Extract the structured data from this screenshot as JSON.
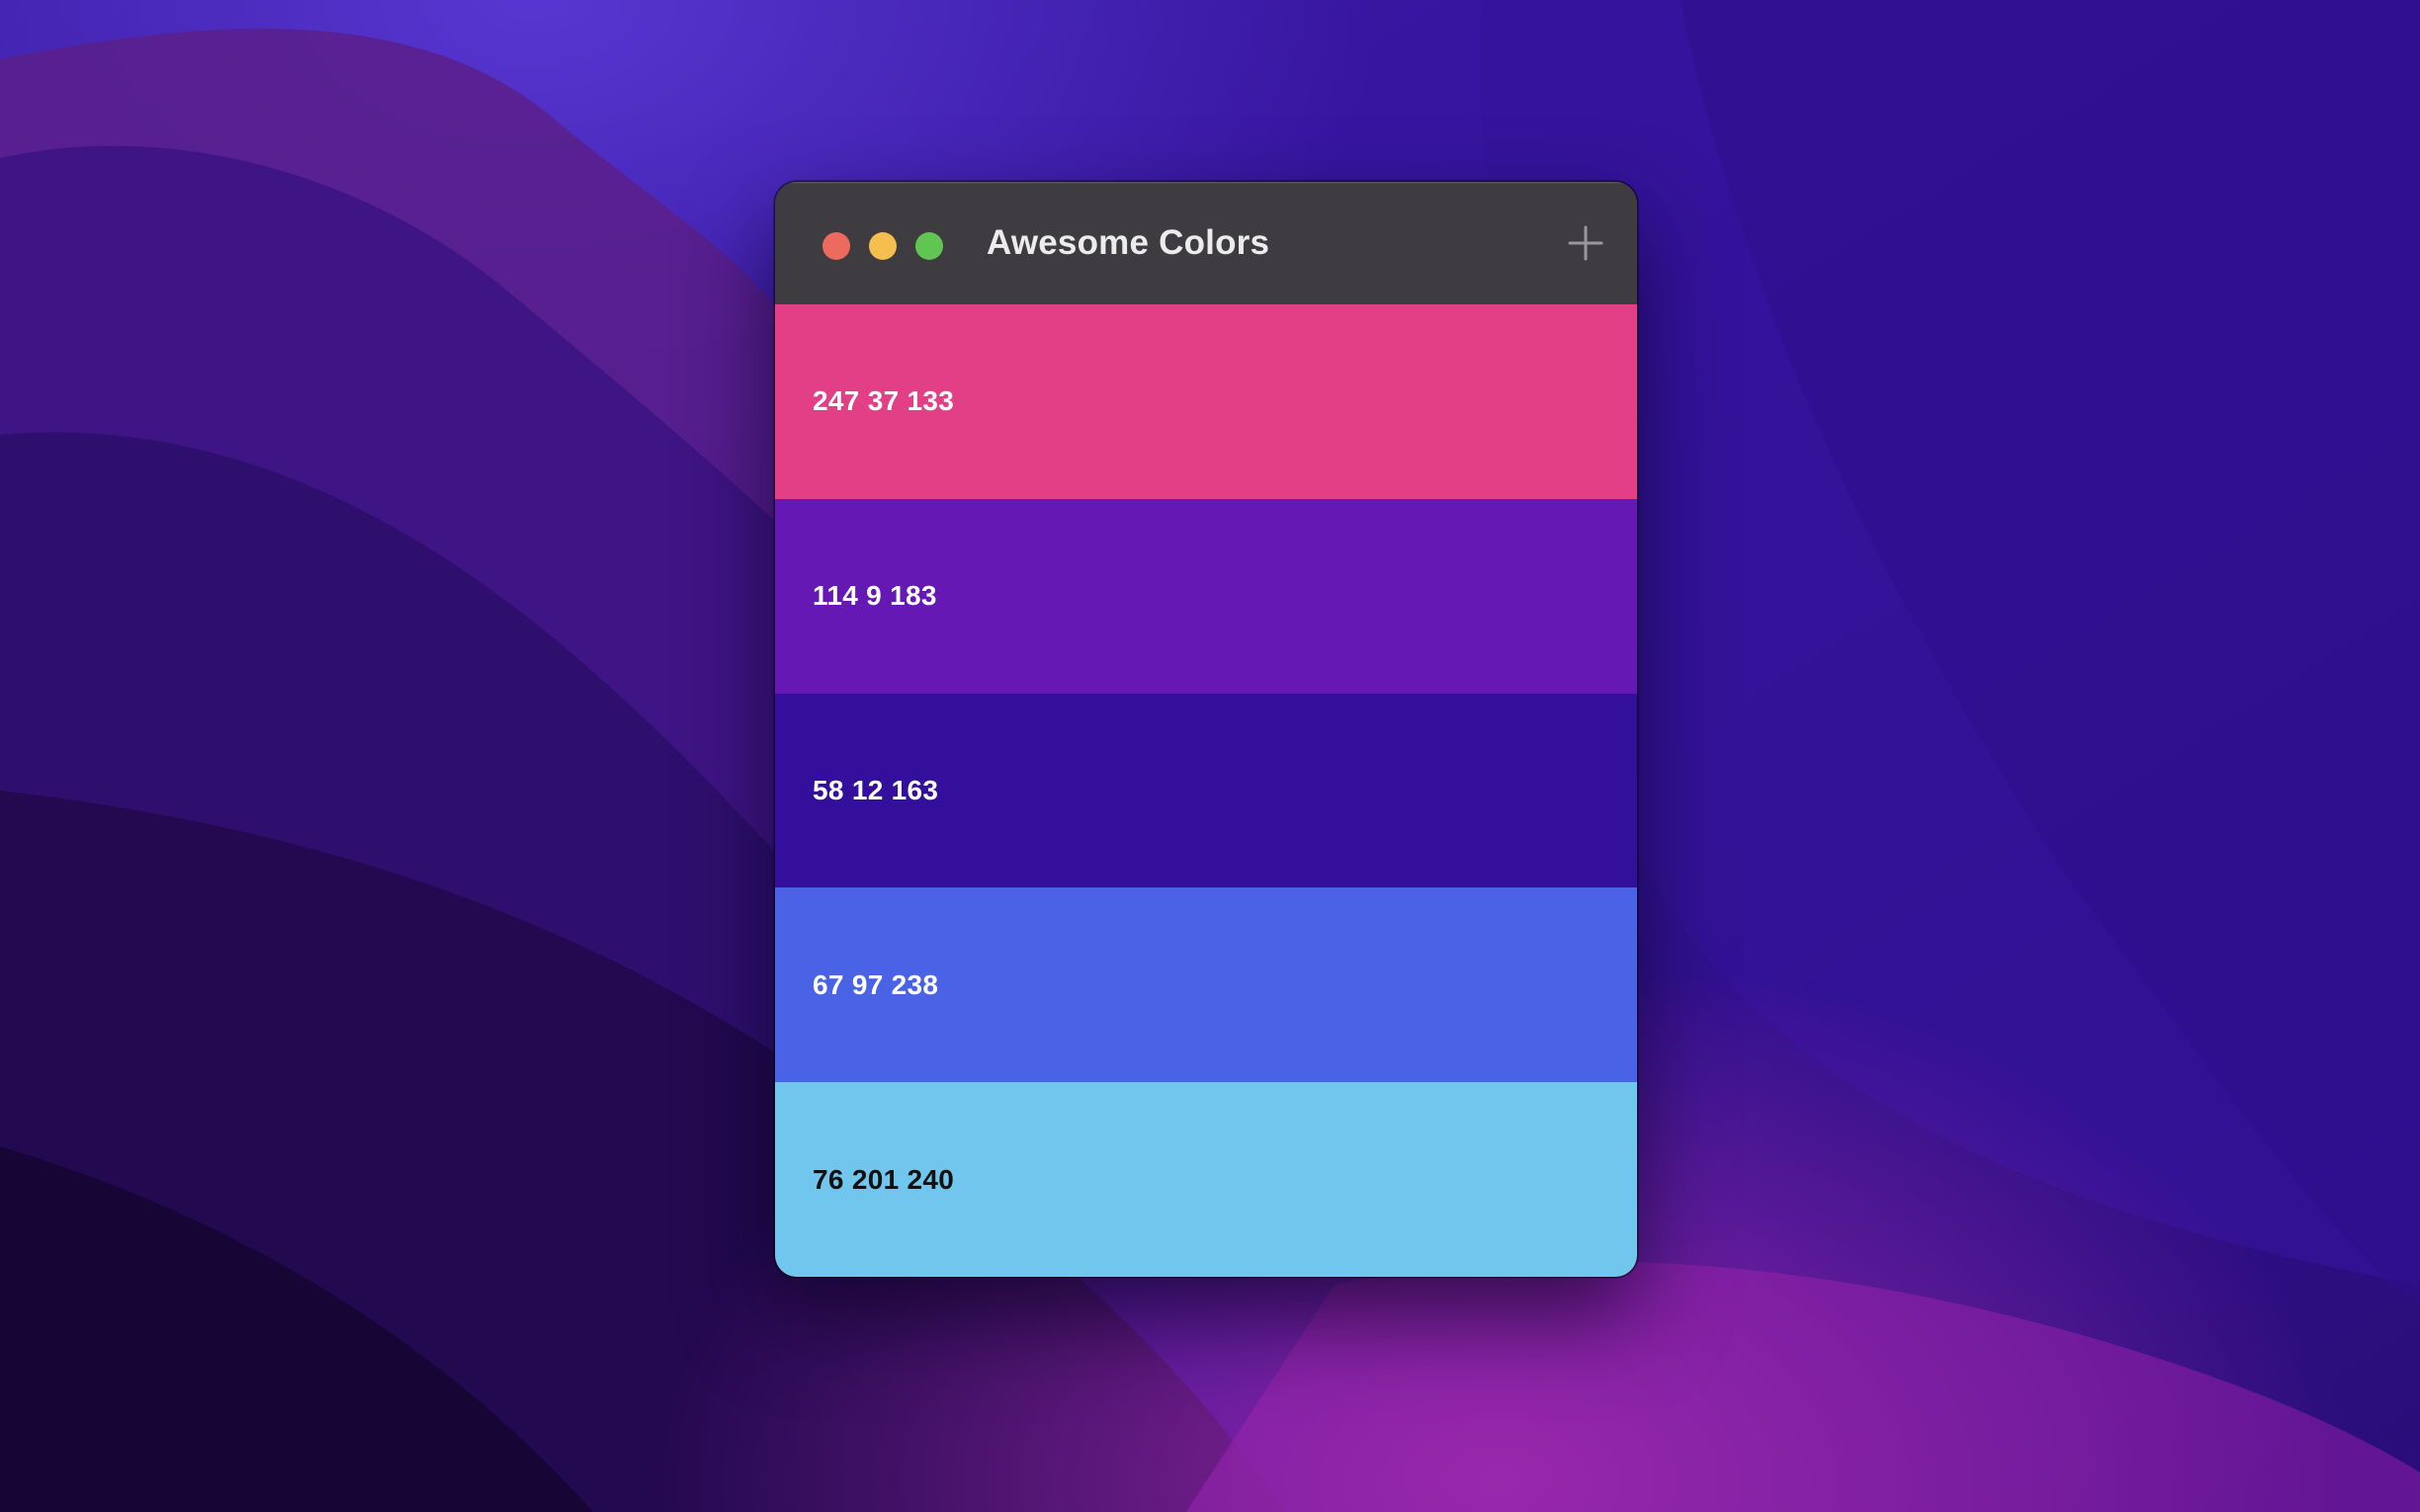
{
  "window": {
    "title": "Awesome Colors",
    "add_icon": "plus-icon"
  },
  "colors": [
    {
      "label": "247 37 133",
      "swatch": "#e23f86",
      "text_color": "#ffffff"
    },
    {
      "label": "114 9 183",
      "swatch": "#6618b5",
      "text_color": "#ffffff"
    },
    {
      "label": "58 12 163",
      "swatch": "#330f9c",
      "text_color": "#ffffff"
    },
    {
      "label": "67 97 238",
      "swatch": "#4a63e6",
      "text_color": "#ffffff"
    },
    {
      "label": "76 201 240",
      "swatch": "#71c6ee",
      "text_color": "#111111"
    }
  ],
  "theme": {
    "titlebar": "#3e3c41",
    "title_text": "#ececec",
    "close": "#ec6a5e",
    "minimize": "#f4bf4f",
    "zoom": "#61c554"
  }
}
